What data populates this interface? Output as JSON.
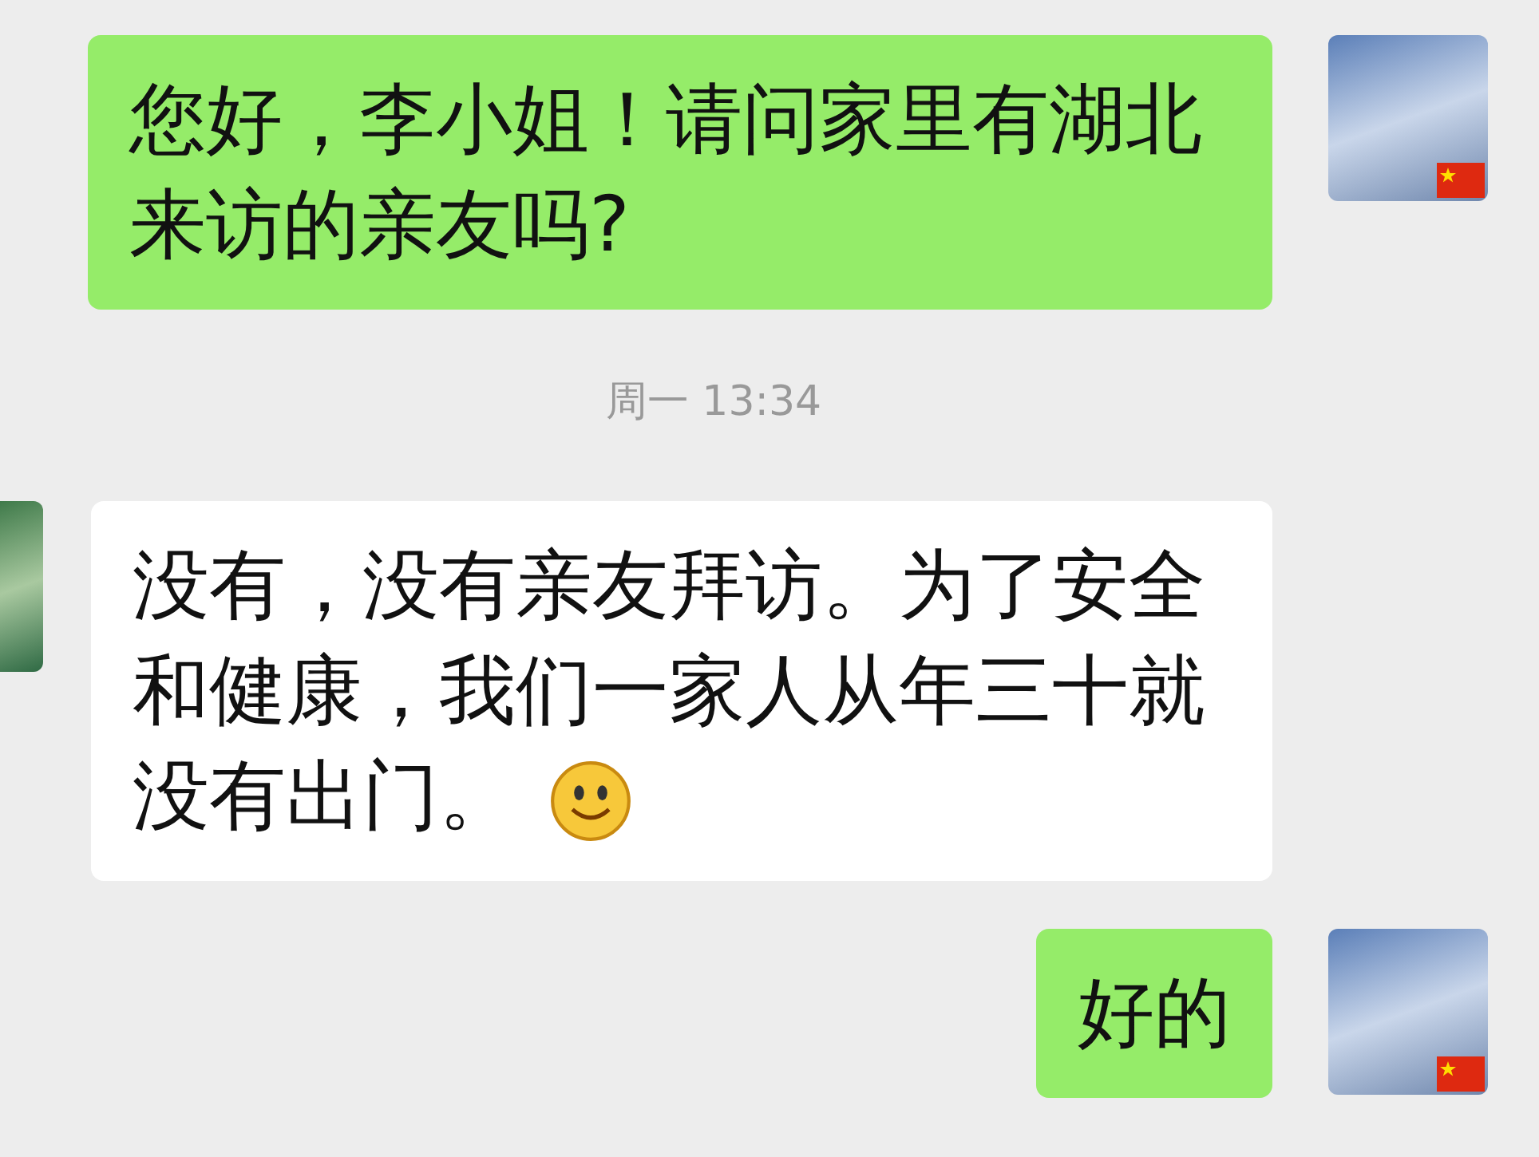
{
  "messages": [
    {
      "kind": "outgoing",
      "text": "您好，李小姐！请问家里有湖北来访的亲友吗?",
      "emoji": false
    },
    {
      "kind": "time",
      "text": "周一 13:34"
    },
    {
      "kind": "incoming",
      "text": "没有，没有亲友拜访。为了安全和健康，我们一家人从年三十就没有出门。",
      "emoji": true
    },
    {
      "kind": "outgoing",
      "text": "好的",
      "emoji": false
    }
  ]
}
